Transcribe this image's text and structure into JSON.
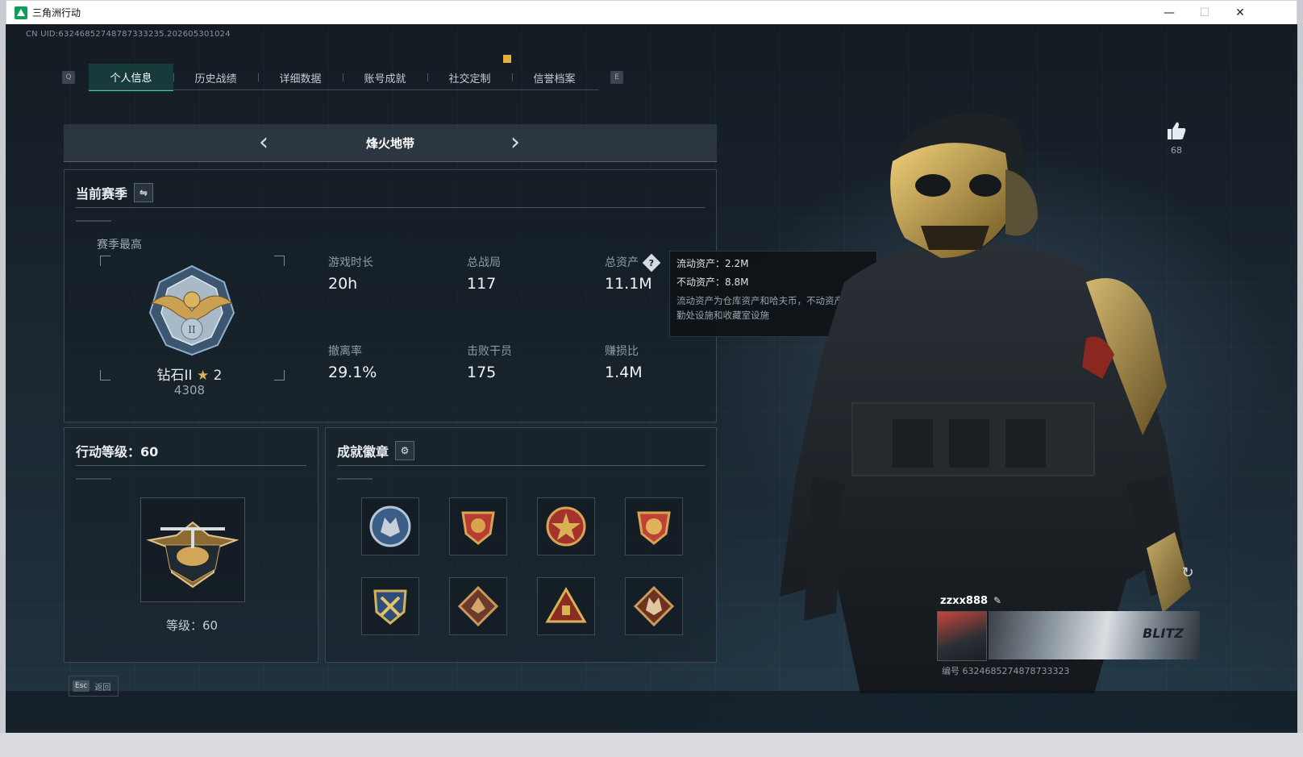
{
  "window": {
    "title": "三角洲行动",
    "controls": [
      "—",
      "☐",
      "✕"
    ]
  },
  "uid": "CN UID:6324685274878733323​5.202605301024",
  "tabs": {
    "left_key": "Q",
    "right_key": "E",
    "items": [
      {
        "label": "个人信息",
        "active": true
      },
      {
        "label": "历史战绩",
        "active": false
      },
      {
        "label": "详细数据",
        "active": false
      },
      {
        "label": "账号成就",
        "active": false
      },
      {
        "label": "社交定制",
        "active": false
      },
      {
        "label": "信誉档案",
        "active": false
      }
    ]
  },
  "mode": {
    "title": "烽火地带",
    "prev": "‹",
    "next": "›"
  },
  "season": {
    "heading": "当前赛季",
    "toggle_icon": "⇋",
    "best_label": "赛季最高",
    "rank_name": "钻石II",
    "rank_stars": "2",
    "rank_score": "4308",
    "stats": [
      {
        "label": "游戏时长",
        "value": "20h"
      },
      {
        "label": "总战局",
        "value": "117"
      },
      {
        "label": "总资产",
        "value": "11.1M",
        "help": "?"
      },
      {
        "label": "撤离率",
        "value": "29.1%"
      },
      {
        "label": "击败干员",
        "value": "175"
      },
      {
        "label": "赚损比",
        "value": "1.4M"
      }
    ]
  },
  "tooltip": {
    "liquid": "流动资产：2.2M",
    "fixed": "不动资产：8.8M",
    "desc": "流动资产为仓库资产和哈夫币，不动资产为特勤处设施和收藏室设施"
  },
  "level": {
    "heading": "行动等级：60",
    "label": "等级：60"
  },
  "badges": {
    "heading": "成就徽章",
    "settings_icon": "⚙",
    "count": 8
  },
  "like": {
    "count": "68"
  },
  "player": {
    "name": "zzxx888",
    "id_text": "编号 6324685274878733323",
    "banner_text": "BLITZ"
  },
  "esc": {
    "key": "Esc",
    "label": "返回"
  },
  "colors": {
    "accent": "#2fd59c",
    "gold": "#c9a34a",
    "panel_border": "#3a4651"
  }
}
